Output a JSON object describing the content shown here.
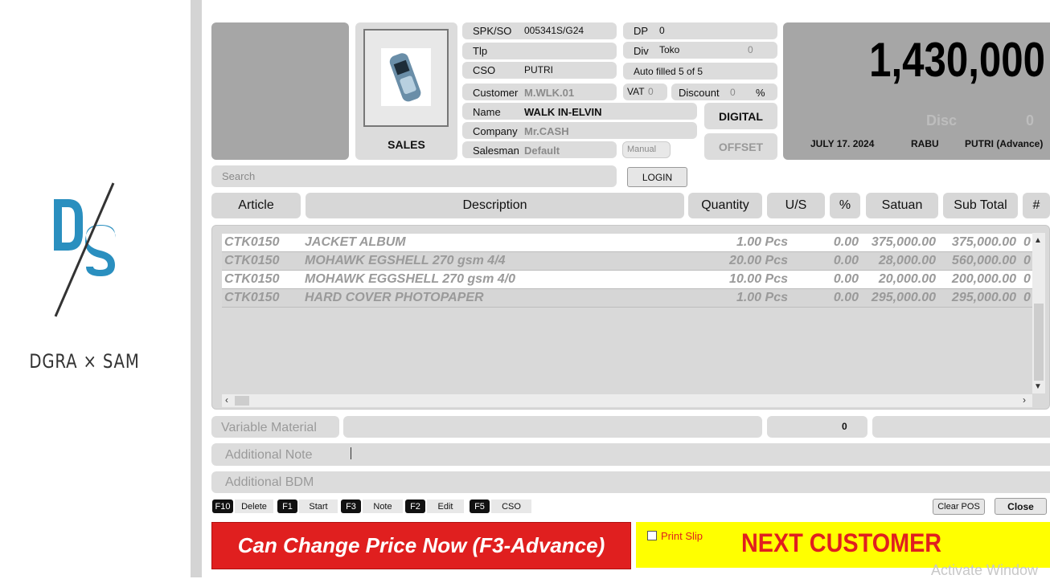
{
  "brand": {
    "name": "DGRA × SAM"
  },
  "product": {
    "label": "SALES"
  },
  "fields": {
    "spk_label": "SPK/SO",
    "spk_value": "005341S/G24",
    "tlp_label": "Tlp",
    "tlp_value": "",
    "cso_label": "CSO",
    "cso_value": "PUTRI",
    "customer_label": "Customer",
    "customer_value": "M.WLK.01",
    "name_label": "Name",
    "name_value": "WALK IN-ELVIN",
    "company_label": "Company",
    "company_value": "Mr.CASH",
    "salesman_label": "Salesman",
    "salesman_value": "Default",
    "manual_label": "Manual",
    "dp_label": "DP",
    "dp_value": "0",
    "div_label": "Div",
    "div_value": "Toko",
    "div_num": "0",
    "autofill": "Auto filled 5 of 5",
    "vat_label": "VAT",
    "vat_value": "0",
    "discount_label": "Discount",
    "discount_value": "0",
    "percent": "%",
    "digital": "DIGITAL",
    "offset": "OFFSET"
  },
  "total": {
    "amount": "1,430,000",
    "disc_label": "Disc",
    "disc_value": "0",
    "date": "JULY 17. 2024",
    "day": "RABU",
    "user": "PUTRI (Advance)"
  },
  "search": {
    "placeholder": "Search",
    "login": "LOGIN"
  },
  "columns": [
    "Article",
    "Description",
    "Quantity",
    "U/S",
    "%",
    "Satuan",
    "Sub Total",
    "#"
  ],
  "rows": [
    {
      "article": "CTK0150",
      "desc": "JACKET ALBUM",
      "qty": "1.00 Pcs",
      "pct": "0.00",
      "satuan": "375,000.00",
      "subtotal": "375,000.00",
      "hash": "0"
    },
    {
      "article": "CTK0150",
      "desc": "MOHAWK EGSHELL 270 gsm 4/4",
      "qty": "20.00 Pcs",
      "pct": "0.00",
      "satuan": "28,000.00",
      "subtotal": "560,000.00",
      "hash": "0"
    },
    {
      "article": "CTK0150",
      "desc": "MOHAWK EGGSHELL 270 gsm 4/0",
      "qty": "10.00 Pcs",
      "pct": "0.00",
      "satuan": "20,000.00",
      "subtotal": "200,000.00",
      "hash": "0"
    },
    {
      "article": "CTK0150",
      "desc": "HARD COVER PHOTOPAPER",
      "qty": "1.00 Pcs",
      "pct": "0.00",
      "satuan": "295,000.00",
      "subtotal": "295,000.00",
      "hash": "0"
    }
  ],
  "extra": {
    "variable_material": "Variable Material",
    "vm_value": "0",
    "additional_note": "Additional Note",
    "additional_bdm": "Additional BDM"
  },
  "shortcuts": [
    {
      "key": "F10",
      "label": "Delete"
    },
    {
      "key": "F1",
      "label": "Start"
    },
    {
      "key": "F3",
      "label": "Note"
    },
    {
      "key": "F2",
      "label": "Edit"
    },
    {
      "key": "F5",
      "label": "CSO"
    }
  ],
  "actions": {
    "clear_pos": "Clear POS",
    "close": "Close"
  },
  "banner": {
    "change_price": "Can Change Price Now (F3-Advance)",
    "print_slip": "Print Slip",
    "next_customer": "NEXT CUSTOMER"
  },
  "watermark": "Activate Window",
  "colors": {
    "red": "#e01f1f",
    "yellow": "#ffff00",
    "panel": "#a6a6a6"
  }
}
